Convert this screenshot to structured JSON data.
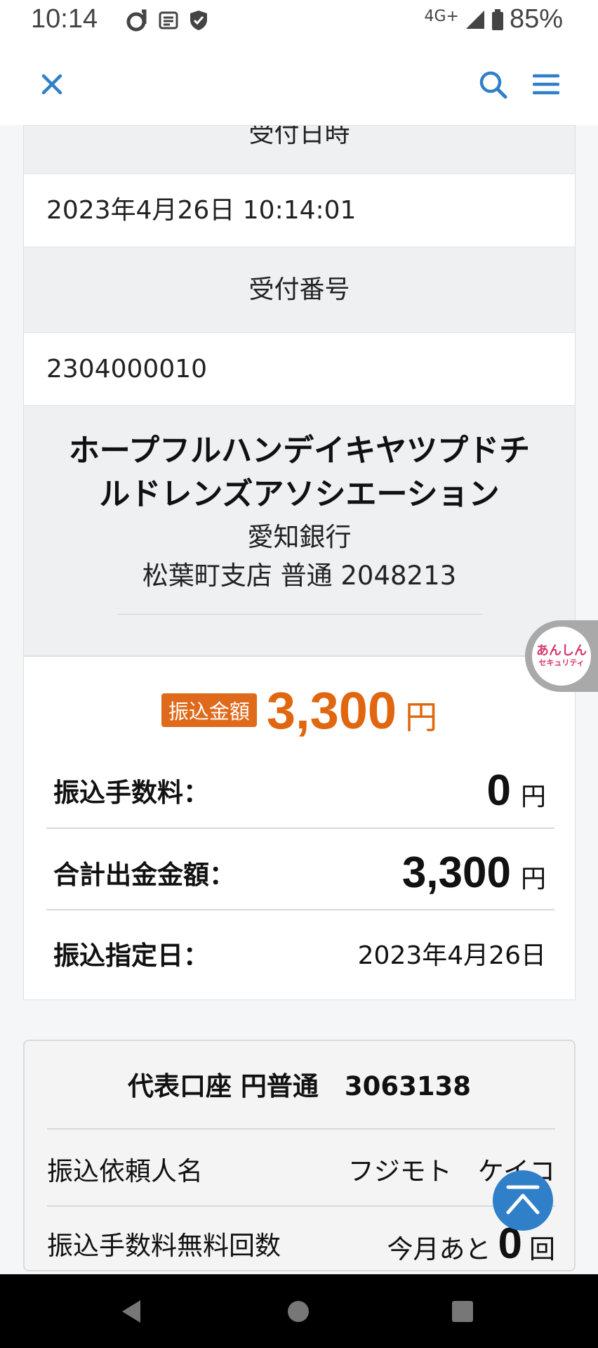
{
  "status_bar": {
    "time": "10:14",
    "network": "4G+",
    "battery": "85%"
  },
  "header": {
    "close_icon": "close-icon",
    "search_icon": "search-icon",
    "menu_icon": "menu-icon"
  },
  "receipt": {
    "datetime_label": "受付日時",
    "datetime_value": "2023年4月26日 10:14:01",
    "number_label": "受付番号",
    "number_value": "2304000010"
  },
  "payee": {
    "name_line1": "ホープフルハンデイキヤツプドチ",
    "name_line2": "ルドレンズアソシエーション",
    "bank": "愛知銀行",
    "branch_account": "松葉町支店 普通 2048213"
  },
  "transfer": {
    "amount_badge": "振込金額",
    "amount": "3,300",
    "amount_unit": "円",
    "fee_label": "振込手数料：",
    "fee_value": "0",
    "fee_unit": "円",
    "total_label": "合計出金金額：",
    "total_value": "3,300",
    "total_unit": "円",
    "date_label": "振込指定日：",
    "date_value": "2023年4月26日"
  },
  "account": {
    "title": "代表口座 円普通　3063138",
    "requester_label": "振込依頼人名",
    "requester_value": "フジモト　ケイコ",
    "free_count_label": "振込手数料無料回数",
    "free_count_prefix": "今月あと",
    "free_count_value": "0",
    "free_count_unit": "回"
  },
  "anshin": {
    "line1": "あんしん",
    "line2": "セキュリティ"
  },
  "colors": {
    "accent_orange": "#e0660f",
    "accent_blue": "#2f7fc9"
  }
}
